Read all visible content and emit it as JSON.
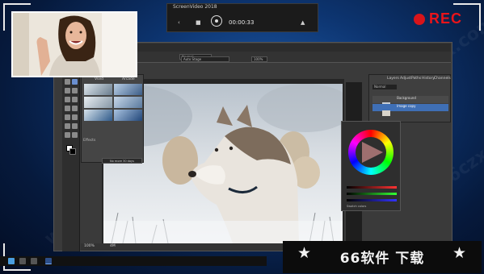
{
  "recorder": {
    "app_name": "ScreenVideo 2018",
    "controls": {
      "back": "‹",
      "stop": "■",
      "timer": "00:00:33",
      "minimize": "▲"
    },
    "rec_label": "REC",
    "rec_color": "#d8141a"
  },
  "editor": {
    "menu": [
      "File",
      "Edit",
      "Image",
      "Layer",
      "Adjust",
      "Filter",
      "View",
      "Window",
      "Help"
    ],
    "option_fields": [
      "Normal",
      "Auto Stage",
      "100%"
    ],
    "presets_panel": {
      "col_left": "Vivid",
      "col_right": "Arcade",
      "filters_label": "Effects",
      "footer_button": "No more 30 days"
    },
    "layers_panel": {
      "tabs": [
        "Layers",
        "Adjust",
        "Paths",
        "History",
        "Channels"
      ],
      "blend": "Normal",
      "layers": [
        "Background",
        "Image copy"
      ]
    },
    "color_panel": {
      "rows": [
        "R",
        "G",
        "B"
      ],
      "swatch_label": "Swatch colors"
    },
    "status": {
      "zoom": "100%",
      "dims": "4M"
    }
  },
  "taskbar": {
    "icons": [
      "start-icon",
      "search-icon",
      "task-view-icon",
      "browser-icon",
      "editor-icon"
    ]
  },
  "watermark": {
    "banner_text": "66软件 下载",
    "star": "★",
    "background_text": "www.66czx.com"
  }
}
